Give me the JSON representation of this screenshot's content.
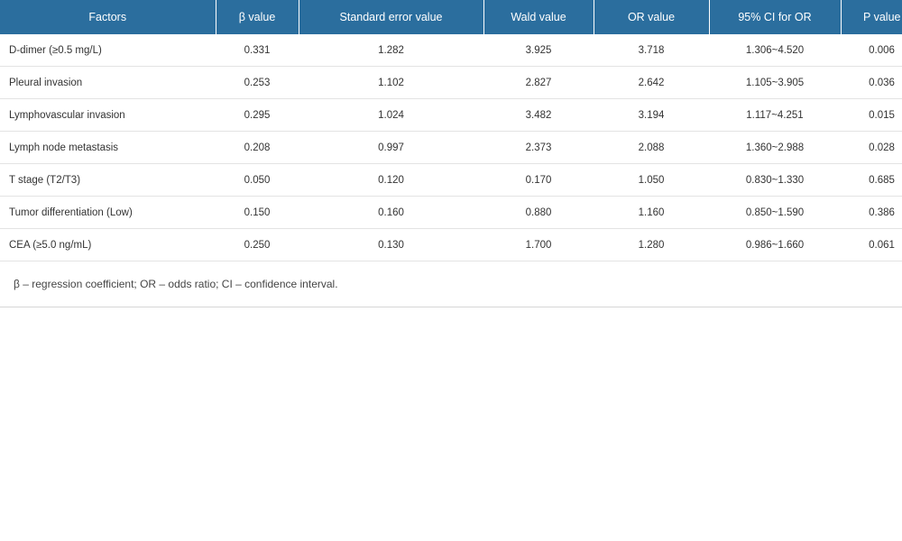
{
  "table": {
    "headers": [
      "Factors",
      "β value",
      "Standard error value",
      "Wald value",
      "OR value",
      "95% CI for OR",
      "P value"
    ],
    "rows": [
      [
        "D-dimer (≥0.5 mg/L)",
        "0.331",
        "1.282",
        "3.925",
        "3.718",
        "1.306~4.520",
        "0.006"
      ],
      [
        "Pleural invasion",
        "0.253",
        "1.102",
        "2.827",
        "2.642",
        "1.105~3.905",
        "0.036"
      ],
      [
        "Lymphovascular invasion",
        "0.295",
        "1.024",
        "3.482",
        "3.194",
        "1.117~4.251",
        "0.015"
      ],
      [
        "Lymph node metastasis",
        "0.208",
        "0.997",
        "2.373",
        "2.088",
        "1.360~2.988",
        "0.028"
      ],
      [
        "T stage (T2/T3)",
        "0.050",
        "0.120",
        "0.170",
        "1.050",
        "0.830~1.330",
        "0.685"
      ],
      [
        "Tumor differentiation (Low)",
        "0.150",
        "0.160",
        "0.880",
        "1.160",
        "0.850~1.590",
        "0.386"
      ],
      [
        "CEA (≥5.0 ng/mL)",
        "0.250",
        "0.130",
        "1.700",
        "1.280",
        "0.986~1.660",
        "0.061"
      ]
    ],
    "footnote": "β – regression coefficient; OR – odds ratio; CI – confidence interval."
  },
  "colors": {
    "header_bg": "#2b6e9e",
    "header_text": "#ffffff",
    "row_divider": "#e3e3e3"
  }
}
